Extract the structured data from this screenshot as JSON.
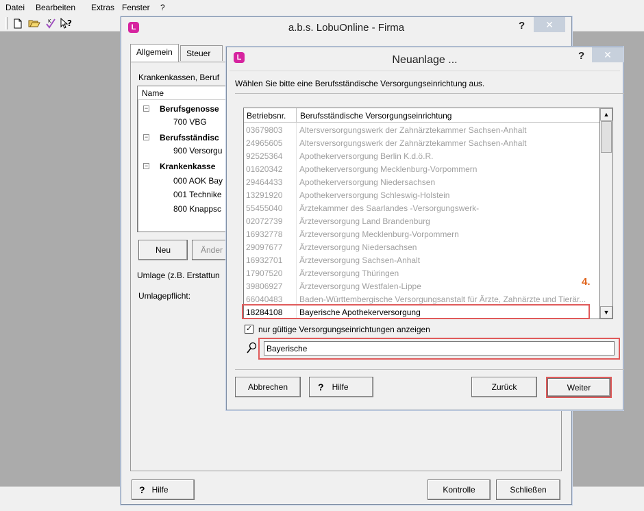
{
  "app": {
    "menu": [
      "Datei",
      "Bearbeiten",
      "Extras",
      "Fenster",
      "?"
    ]
  },
  "firma": {
    "title": "a.b.s. LobuOnline - Firma",
    "tabs": [
      "Allgemein",
      "Steuer"
    ],
    "section_label": "Krankenkassen, Beruf",
    "tree_header": "Name",
    "tree": [
      {
        "label": "Berufsgenosse",
        "level": 0,
        "bold": true
      },
      {
        "label": "700 VBG",
        "level": 1,
        "bold": false
      },
      {
        "label": "Berufsständisc",
        "level": 0,
        "bold": true
      },
      {
        "label": "900 Versorgu",
        "level": 1,
        "bold": false
      },
      {
        "label": "Krankenkasse",
        "level": 0,
        "bold": true
      },
      {
        "label": "000 AOK Bay",
        "level": 1,
        "bold": false
      },
      {
        "label": "001 Technike",
        "level": 1,
        "bold": false
      },
      {
        "label": "800 Knappsc",
        "level": 1,
        "bold": false
      }
    ],
    "new_button": "Neu",
    "change_button": "Änder",
    "umlage_text": "Umlage (z.B. Erstattun",
    "umlagepflicht_label": "Umlagepflicht:",
    "help_button": "Hilfe",
    "control_button": "Kontrolle",
    "close_button": "Schließen"
  },
  "dialog": {
    "title": "Neuanlage ...",
    "instruction": "Wählen Sie bitte eine Berufsständische Versorgungseinrichtung aus.",
    "columns": [
      "Betriebsnr.",
      "Berufsständische Versorgungseinrichtung"
    ],
    "rows": [
      {
        "nr": "03679803",
        "name": "Altersversorgungswerk der Zahnärztekammer Sachsen-Anhalt"
      },
      {
        "nr": "24965605",
        "name": "Altersversorgungswerk der Zahnärztekammer Sachsen-Anhalt"
      },
      {
        "nr": "92525364",
        "name": "Apothekerversorgung Berlin K.d.ö.R."
      },
      {
        "nr": "01620342",
        "name": "Apothekerversorgung Mecklenburg-Vorpommern"
      },
      {
        "nr": "29464433",
        "name": "Apothekerversorgung Niedersachsen"
      },
      {
        "nr": "13291920",
        "name": "Apothekerversorgung Schleswig-Holstein"
      },
      {
        "nr": "55455040",
        "name": "Ärztekammer des Saarlandes -Versorgungswerk-"
      },
      {
        "nr": "02072739",
        "name": "Ärzteversorgung Land Brandenburg"
      },
      {
        "nr": "16932778",
        "name": "Ärzteversorgung Mecklenburg-Vorpommern"
      },
      {
        "nr": "29097677",
        "name": "Ärzteversorgung Niedersachsen"
      },
      {
        "nr": "16932701",
        "name": "Ärzteversorgung Sachsen-Anhalt"
      },
      {
        "nr": "17907520",
        "name": "Ärzteversorgung Thüringen"
      },
      {
        "nr": "39806927",
        "name": "Ärzteversorgung Westfalen-Lippe"
      },
      {
        "nr": "66040483",
        "name": "Baden-Württembergische Versorgungsanstalt für Ärzte, Zahnärzte und Tierär..."
      },
      {
        "nr": "18284108",
        "name": "Bayerische Apothekerversorgung",
        "selected": true
      }
    ],
    "step_marker": "4.",
    "checkbox_label": "nur gültige Versorgungseinrichtungen anzeigen",
    "checkbox_checked": true,
    "search_value": "Bayerische",
    "cancel_button": "Abbrechen",
    "help_button": "Hilfe",
    "back_button": "Zurück",
    "next_button": "Weiter"
  }
}
